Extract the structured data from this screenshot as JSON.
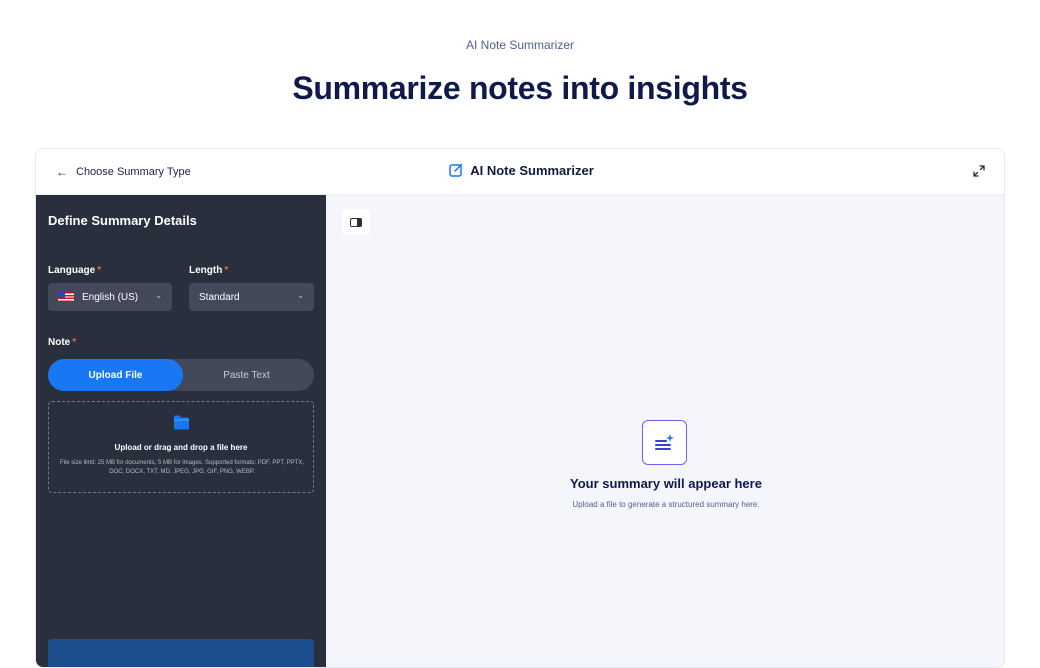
{
  "page": {
    "eyebrow": "AI Note Summarizer",
    "headline": "Summarize notes into insights"
  },
  "topbar": {
    "back_label": "Choose Summary Type",
    "title": "AI Note Summarizer"
  },
  "sidebar": {
    "title": "Define Summary Details",
    "language": {
      "label": "Language",
      "value": "English (US)"
    },
    "length": {
      "label": "Length",
      "value": "Standard"
    },
    "note": {
      "label": "Note"
    },
    "required_mark": "*",
    "tabs": {
      "upload": "Upload File",
      "paste": "Paste Text",
      "active": "upload"
    },
    "dropzone": {
      "title": "Upload or drag and drop a file here",
      "hint": "File size limit: 25 MB for documents, 5 MB for images. Supported formats: PDF, PPT, PPTX, DOC, DOCX, TXT, MD, JPEG, JPG, GIF, PNG, WEBP."
    }
  },
  "main": {
    "empty_title": "Your summary will appear here",
    "empty_subtitle": "Upload a file to generate a structured summary here."
  },
  "colors": {
    "accent": "#1877f2",
    "sidebar_bg": "#2a2f3d",
    "heading": "#0f1a4c",
    "required": "#ff5a5a",
    "empty_icon_border": "#7b5cf0"
  },
  "icons": {
    "back": "arrow-left-icon",
    "title": "edit-icon",
    "expand": "expand-icon",
    "flag": "us-flag-icon",
    "dropdown": "chevron-down-icon",
    "upload": "folder-icon",
    "panel": "panel-toggle-icon",
    "empty": "summary-sparkle-icon"
  }
}
